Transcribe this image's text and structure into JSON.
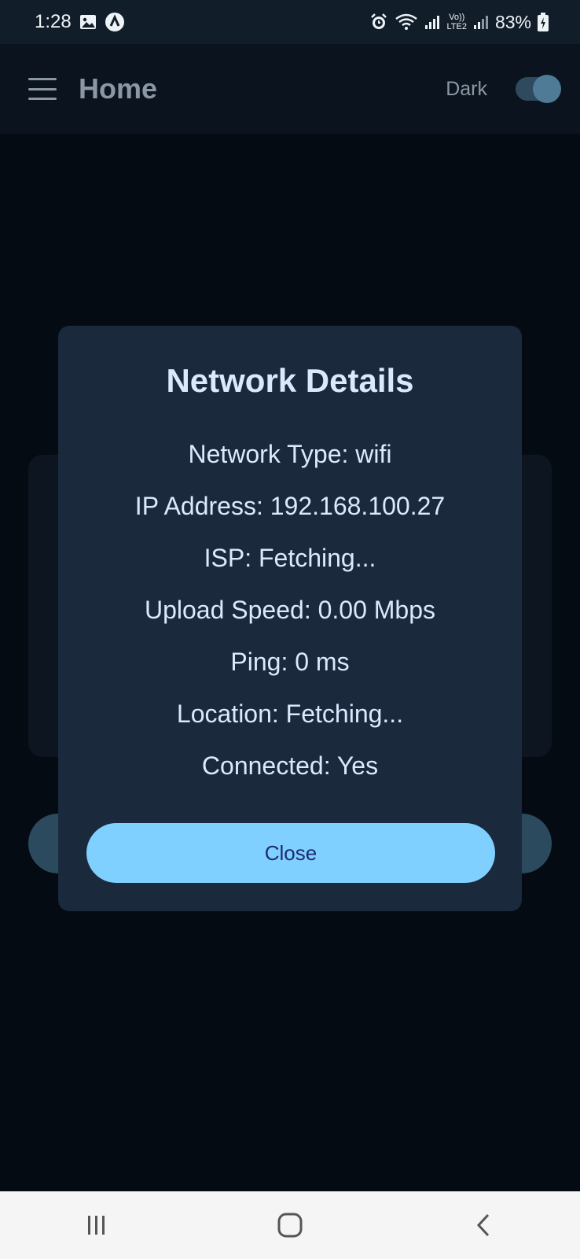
{
  "status_bar": {
    "time": "1:28",
    "battery": "83%",
    "network_label_top": "Vo))",
    "network_label_bottom": "LTE2"
  },
  "app_bar": {
    "title": "Home",
    "theme_label": "Dark",
    "dark_mode_enabled": true
  },
  "dialog": {
    "title": "Network Details",
    "details": [
      "Network Type: wifi",
      "IP Address: 192.168.100.27",
      "ISP: Fetching...",
      "Upload Speed: 0.00 Mbps",
      "Ping: 0 ms",
      "Location: Fetching...",
      "Connected: Yes"
    ],
    "close_label": "Close"
  },
  "colors": {
    "accent": "#80d0ff",
    "dialog_bg": "#1a2a3c",
    "page_bg": "#050b12"
  },
  "nav_bar": {
    "icons": [
      "recents-icon",
      "home-icon",
      "back-icon"
    ]
  }
}
